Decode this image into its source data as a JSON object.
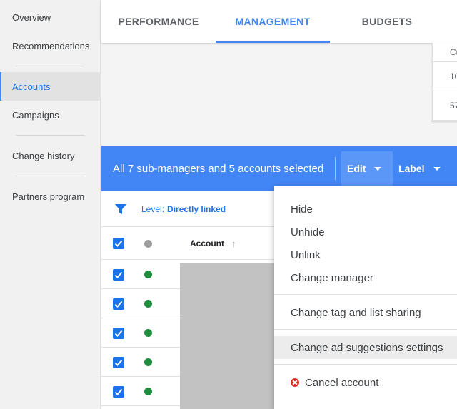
{
  "sidebar": {
    "items": [
      {
        "label": "Overview"
      },
      {
        "label": "Recommendations"
      },
      {
        "label": "Accounts",
        "active": true
      },
      {
        "label": "Campaigns"
      },
      {
        "label": "Change history"
      },
      {
        "label": "Partners program"
      }
    ]
  },
  "tabs": [
    {
      "label": "PERFORMANCE"
    },
    {
      "label": "MANAGEMENT",
      "active": true
    },
    {
      "label": "BUDGETS"
    }
  ],
  "peek_table": {
    "cells": [
      "Cu",
      "10",
      "57"
    ]
  },
  "selection_bar": {
    "text": "All 7 sub-managers and 5 accounts selected",
    "edit_label": "Edit",
    "label_label": "Label"
  },
  "filter": {
    "prefix": "Level:",
    "value": "Directly linked"
  },
  "table": {
    "header": {
      "account": "Account",
      "sort": "↑"
    },
    "rows": [
      {
        "checked": true,
        "status": "green"
      },
      {
        "checked": true,
        "status": "green"
      },
      {
        "checked": true,
        "status": "green"
      },
      {
        "checked": true,
        "status": "green"
      },
      {
        "checked": true,
        "status": "green"
      }
    ]
  },
  "menu": {
    "items": [
      {
        "label": "Hide"
      },
      {
        "label": "Unhide"
      },
      {
        "label": "Unlink"
      },
      {
        "label": "Change manager"
      },
      {
        "label": "Change tag and list sharing"
      },
      {
        "label": "Change ad suggestions settings",
        "hover": true
      },
      {
        "label": "Cancel account",
        "icon": "cancel-icon"
      }
    ]
  },
  "colors": {
    "accent": "#4285f4",
    "status_green": "#1e8e3e",
    "cancel_red": "#d93025"
  }
}
